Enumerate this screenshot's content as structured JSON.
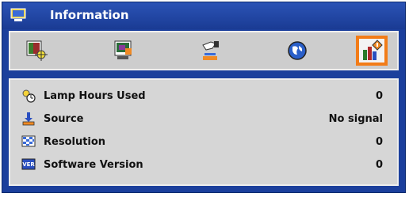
{
  "window": {
    "title": "Information",
    "icon": "settings-monitor-icon"
  },
  "tabs": [
    {
      "name": "image-settings-icon",
      "active": false
    },
    {
      "name": "display-screen-icon",
      "active": false
    },
    {
      "name": "setup-hand-icon",
      "active": false
    },
    {
      "name": "options-globe-icon",
      "active": false
    },
    {
      "name": "information-chart-icon",
      "active": true
    }
  ],
  "info": {
    "rows": [
      {
        "icon": "lamp-clock-icon",
        "label": "Lamp Hours Used",
        "value": "0"
      },
      {
        "icon": "source-input-icon",
        "label": "Source",
        "value": "No signal"
      },
      {
        "icon": "resolution-grid-icon",
        "label": "Resolution",
        "value": "0"
      },
      {
        "icon": "version-badge-icon",
        "label": "Software Version",
        "value": "0"
      }
    ]
  },
  "colors": {
    "frame": "#1b3f9c",
    "panel": "#d6d6d6",
    "active_tab_border": "#f27c18"
  }
}
